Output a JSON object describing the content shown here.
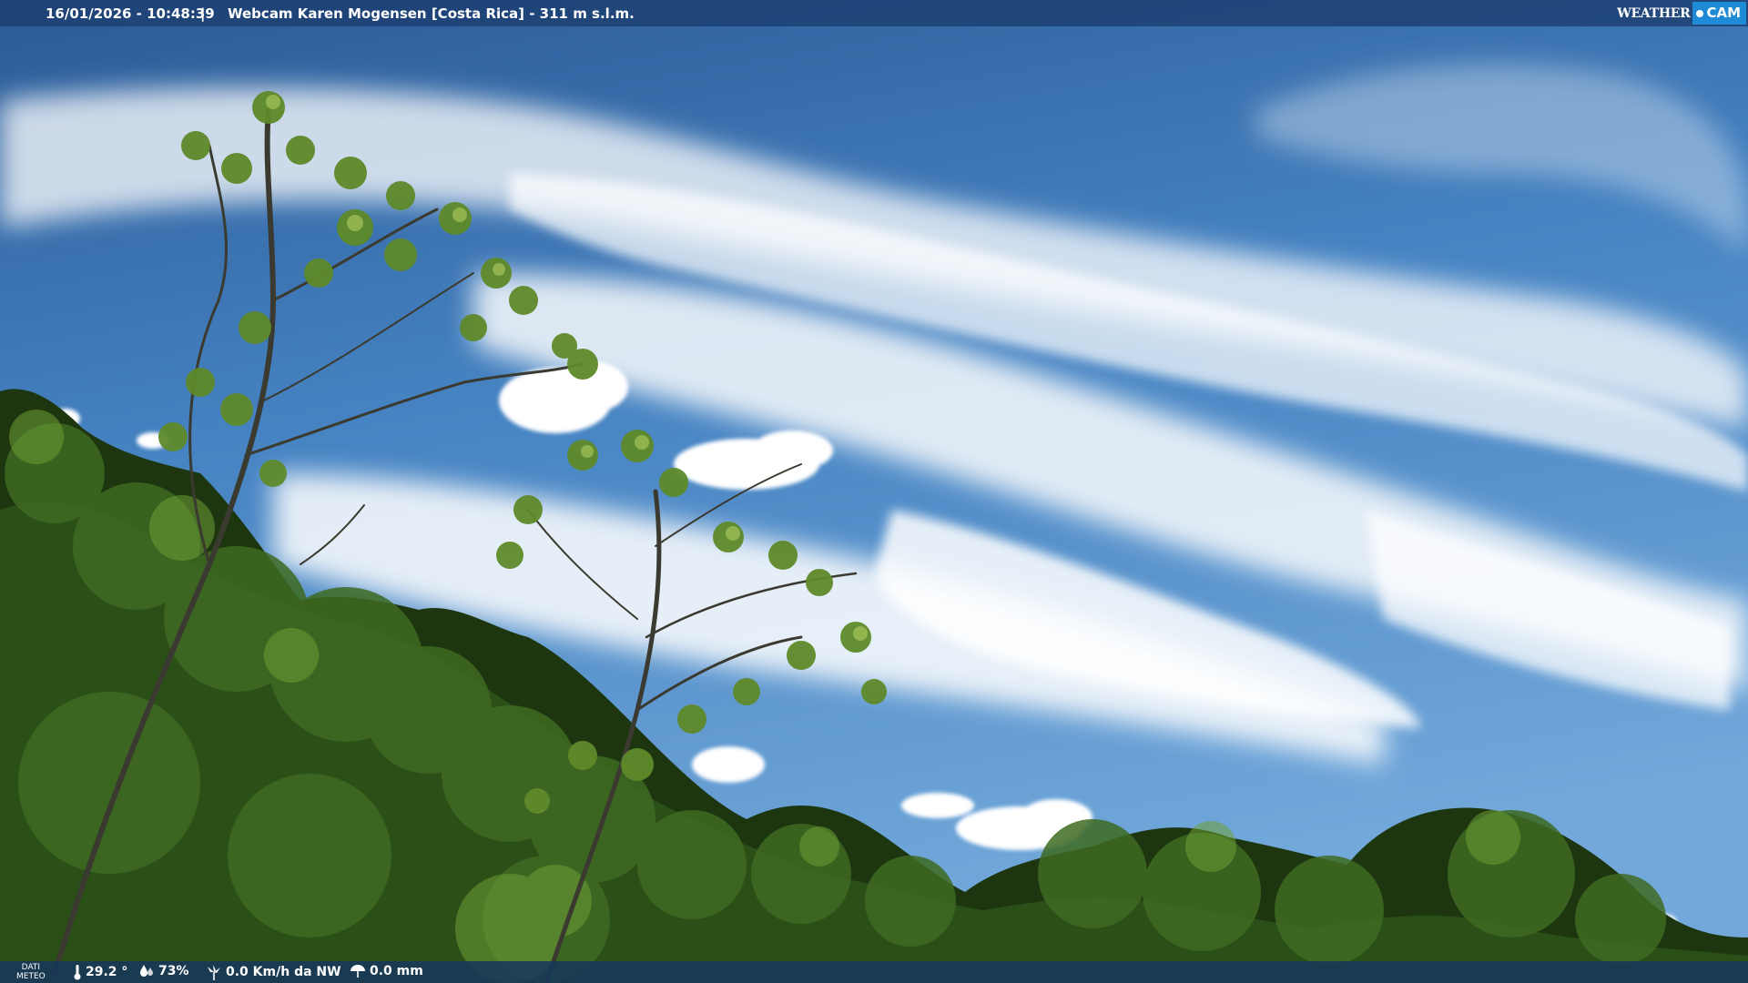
{
  "header": {
    "datetime": "16/01/2026 - 10:48:39",
    "separator": "|",
    "title": "Webcam Karen Mogensen [Costa Rica] - 311 m s.l.m."
  },
  "logo": {
    "weather": "WEATHER",
    "cam": "CAM"
  },
  "footer": {
    "label_line1": "DATI",
    "label_line2": "METEO",
    "temperature": "29.2 °",
    "humidity": "73%",
    "wind": "0.0 Km/h da NW",
    "rain": "0.0 mm"
  },
  "colors": {
    "sky_top": "#2e5f9c",
    "sky_mid": "#4a86c4",
    "sky_low": "#6fa6d8",
    "cloud": "#ffffff",
    "foliage_dark": "#1e3a12",
    "foliage_mid": "#3f6e22",
    "foliage_light": "#7fae3e",
    "logo_accent": "#1f8ad6"
  },
  "icons": [
    "thermometer-icon",
    "humidity-icon",
    "wind-icon",
    "rain-gauge-icon"
  ]
}
